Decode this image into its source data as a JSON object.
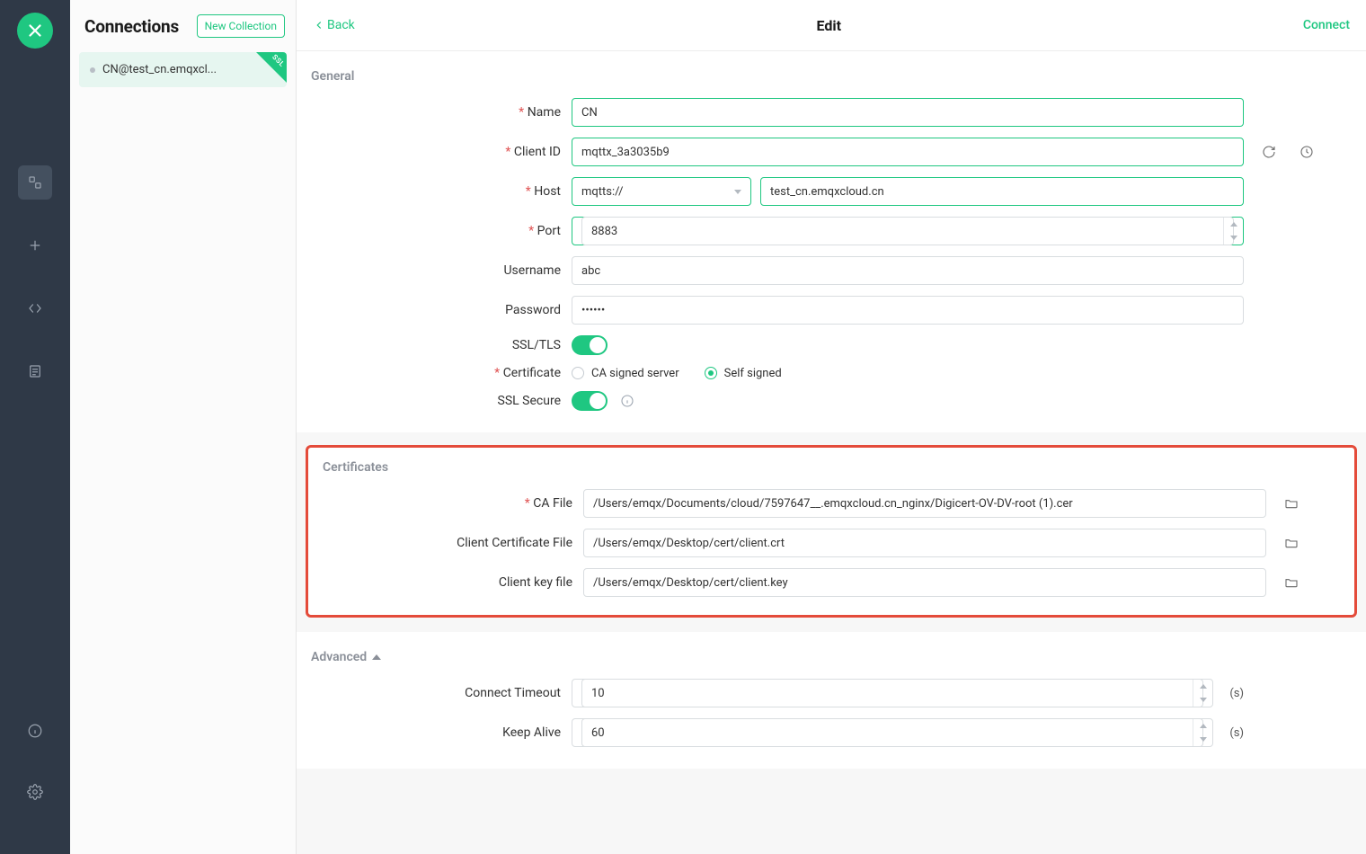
{
  "rail": {
    "items": [
      "connections-icon",
      "new-icon",
      "script-icon",
      "log-icon"
    ],
    "bottom": [
      "about-icon",
      "settings-icon"
    ]
  },
  "sidebar": {
    "title": "Connections",
    "new_collection": "New Collection",
    "items": [
      {
        "name": "CN@test_cn.emqxcl...",
        "ssl_badge": "SSL"
      }
    ]
  },
  "topbar": {
    "back": "Back",
    "title": "Edit",
    "connect": "Connect"
  },
  "general": {
    "heading": "General",
    "name_label": "Name",
    "name_value": "CN",
    "client_id_label": "Client ID",
    "client_id_value": "mqttx_3a3035b9",
    "host_label": "Host",
    "scheme_value": "mqtts://",
    "host_value": "test_cn.emqxcloud.cn",
    "port_label": "Port",
    "port_value": "8883",
    "username_label": "Username",
    "username_value": "abc",
    "password_label": "Password",
    "password_value": "••••••",
    "ssl_label": "SSL/TLS",
    "certificate_label": "Certificate",
    "cert_opt_ca": "CA signed server",
    "cert_opt_self": "Self signed",
    "ssl_secure_label": "SSL Secure"
  },
  "certificates": {
    "heading": "Certificates",
    "ca_file_label": "CA File",
    "ca_file_value": "/Users/emqx/Documents/cloud/7597647__.emqxcloud.cn_nginx/Digicert-OV-DV-root (1).cer",
    "client_cert_label": "Client Certificate File",
    "client_cert_value": "/Users/emqx/Desktop/cert/client.crt",
    "client_key_label": "Client key file",
    "client_key_value": "/Users/emqx/Desktop/cert/client.key"
  },
  "advanced": {
    "heading": "Advanced",
    "connect_timeout_label": "Connect Timeout",
    "connect_timeout_value": "10",
    "keep_alive_label": "Keep Alive",
    "keep_alive_value": "60",
    "unit_suffix": "(s)"
  }
}
